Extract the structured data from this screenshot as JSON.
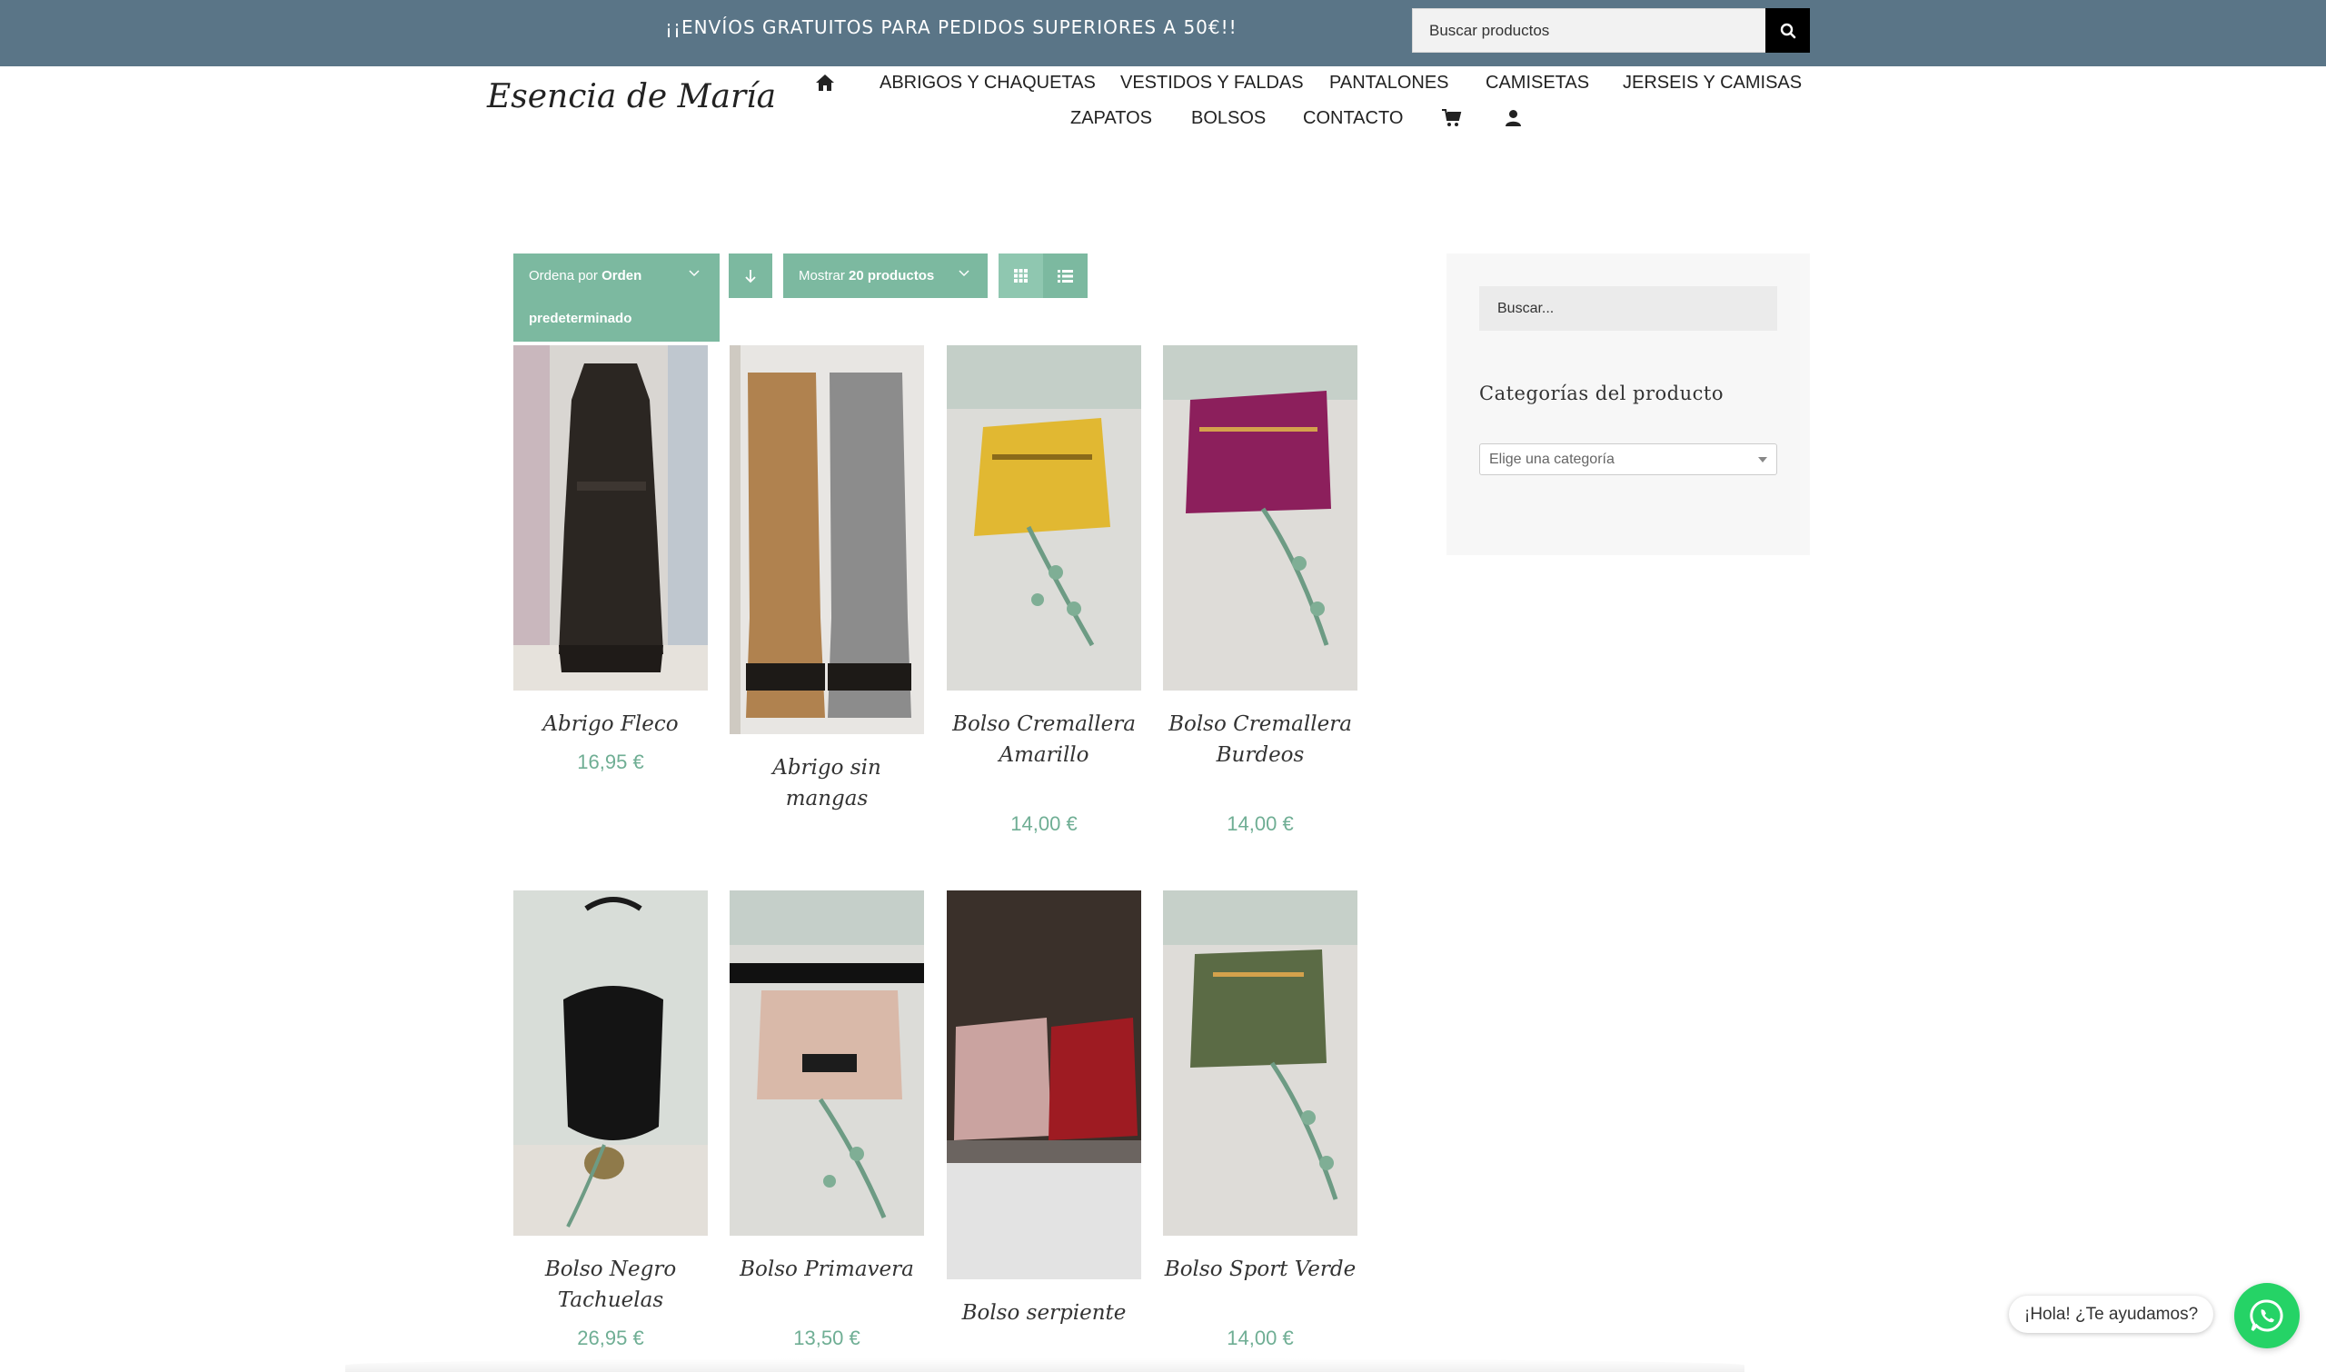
{
  "topbar": {
    "promo": "¡¡ENVÍOS GRATUITOS PARA PEDIDOS SUPERIORES A 50€!!",
    "search_placeholder": "Buscar productos"
  },
  "header": {
    "logo": "Esencia de María",
    "nav": [
      "ABRIGOS Y CHAQUETAS",
      "VESTIDOS Y FALDAS",
      "PANTALONES",
      "CAMISETAS",
      "JERSEIS Y CAMISAS",
      "ZAPATOS",
      "BOLSOS",
      "CONTACTO"
    ]
  },
  "toolbar": {
    "sort_prefix": "Ordena por",
    "sort_value_1": "Orden",
    "sort_value_2": "predeterminado",
    "show_prefix": "Mostrar",
    "show_value": "20 productos"
  },
  "products": [
    {
      "name": "Abrigo Fleco",
      "price": "16,95 €"
    },
    {
      "name": "Abrigo sin mangas",
      "price": ""
    },
    {
      "name": "Bolso Cremallera Amarillo",
      "price": "14,00 €"
    },
    {
      "name": "Bolso Cremallera Burdeos",
      "price": "14,00 €"
    },
    {
      "name": "Bolso Negro Tachuelas",
      "price": "26,95 €"
    },
    {
      "name": "Bolso Primavera",
      "price": "13,50 €"
    },
    {
      "name": "Bolso serpiente",
      "price": ""
    },
    {
      "name": "Bolso Sport Verde",
      "price": "14,00 €"
    }
  ],
  "sidebar": {
    "search_placeholder": "Buscar...",
    "categories_heading": "Categorías del producto",
    "category_select": "Elige una categoría"
  },
  "chat": {
    "bubble": "¡Hola! ¿Te ayudamos?"
  }
}
